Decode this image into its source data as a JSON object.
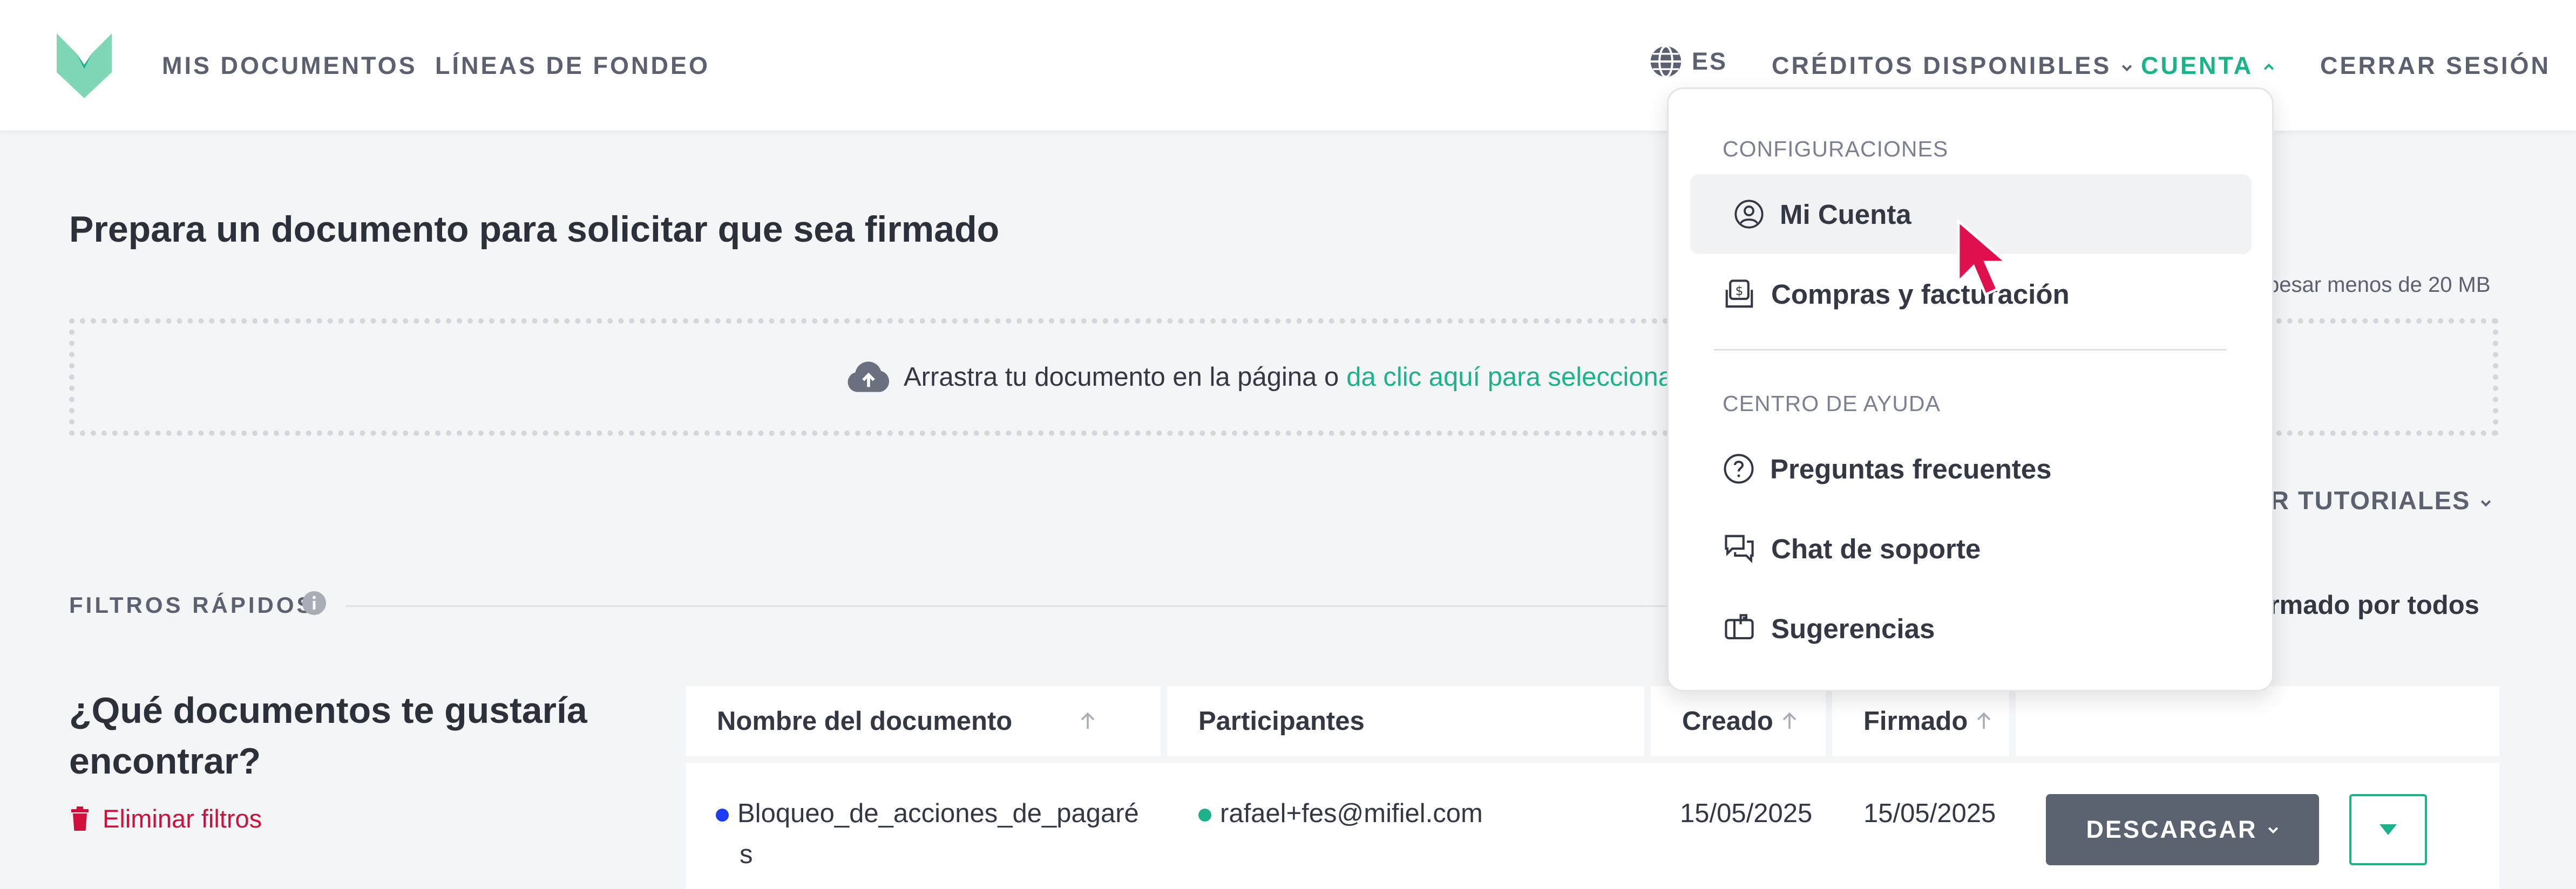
{
  "nav": {
    "logo_alt": "Mifiel",
    "links": [
      "MIS DOCUMENTOS",
      "LÍNEAS DE FONDEO"
    ],
    "language": "ES",
    "credits": "CRÉDITOS DISPONIBLES",
    "account": "CUENTA",
    "logout": "CERRAR SESIÓN"
  },
  "main": {
    "title": "Prepara un documento para solicitar que sea firmado",
    "size_note": "pesar menos de 20 MB",
    "drop_text": "Arrastra tu documento en la página o",
    "drop_link": "da clic aquí para seleccionar",
    "tutorials": "AR TUTORIALES",
    "quick_filters": "FILTROS RÁPIDOS",
    "signed_by_all": "irmado por todos",
    "question": "¿Qué documentos te gustaría encontrar?",
    "clear_filters": "Eliminar filtros"
  },
  "table": {
    "headers": {
      "name": "Nombre del documento",
      "participants": "Participantes",
      "created": "Creado",
      "signed": "Firmado"
    },
    "rows": [
      {
        "name_line1": "Bloqueo_de_acciones_de_pagaré",
        "name_line2": "s",
        "participant": "rafael+fes@mifiel.com",
        "created": "15/05/2025",
        "signed": "15/05/2025",
        "download": "DESCARGAR"
      }
    ]
  },
  "dropdown": {
    "section1": "CONFIGURACIONES",
    "item1": "Mi Cuenta",
    "item2": "Compras y facturación",
    "section2": "CENTRO DE AYUDA",
    "item3": "Preguntas frecuentes",
    "item4": "Chat de soporte",
    "item5": "Sugerencias"
  },
  "colors": {
    "accent": "#1cb38a",
    "danger": "#d0103a",
    "doc_dot": "#1a3cf5",
    "participant_dot": "#1cb38a",
    "button": "#5b6270",
    "cursor": "#e0104f"
  }
}
